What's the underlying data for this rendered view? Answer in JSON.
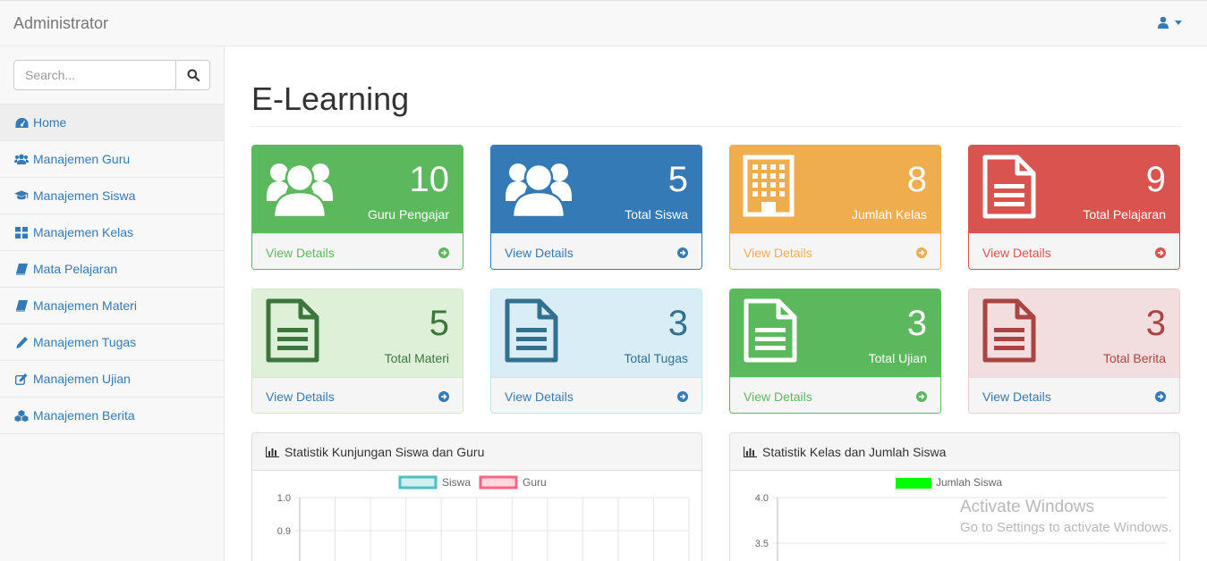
{
  "navbar": {
    "brand": "Administrator"
  },
  "sidebar": {
    "search_placeholder": "Search...",
    "items": [
      {
        "label": "Home"
      },
      {
        "label": "Manajemen Guru"
      },
      {
        "label": "Manajemen Siswa"
      },
      {
        "label": "Manajemen Kelas"
      },
      {
        "label": "Mata Pelajaran"
      },
      {
        "label": "Manajemen Materi"
      },
      {
        "label": "Manajemen Tugas"
      },
      {
        "label": "Manajemen Ujian"
      },
      {
        "label": "Manajemen Berita"
      }
    ]
  },
  "main": {
    "title": "E-Learning",
    "cards": [
      {
        "value": "10",
        "label": "Guru Pengajar",
        "link": "View Details",
        "icon": "users-icon"
      },
      {
        "value": "5",
        "label": "Total Siswa",
        "link": "View Details",
        "icon": "users-icon"
      },
      {
        "value": "8",
        "label": "Jumlah Kelas",
        "link": "View Details",
        "icon": "building-icon"
      },
      {
        "value": "9",
        "label": "Total Pelajaran",
        "link": "View Details",
        "icon": "file-text-icon"
      },
      {
        "value": "5",
        "label": "Total Materi",
        "link": "View Details",
        "icon": "file-text-icon"
      },
      {
        "value": "3",
        "label": "Total Tugas",
        "link": "View Details",
        "icon": "file-text-icon"
      },
      {
        "value": "3",
        "label": "Total Ujian",
        "link": "View Details",
        "icon": "file-text-icon"
      },
      {
        "value": "3",
        "label": "Total Berita",
        "link": "View Details",
        "icon": "file-text-icon"
      }
    ],
    "chart_panels": [
      {
        "title": "Statistik Kunjungan Siswa dan Guru"
      },
      {
        "title": "Statistik Kelas dan Jumlah Siswa"
      }
    ]
  },
  "chart_data": [
    {
      "type": "line",
      "legend_placement": "top",
      "series": [
        {
          "name": "Siswa",
          "color": "#4bc0c0",
          "values": []
        },
        {
          "name": "Guru",
          "color": "#ff6384",
          "values": []
        }
      ],
      "ylim": [
        0,
        1.0
      ],
      "yticks": [
        "1.0",
        "0.9"
      ],
      "grid": true
    },
    {
      "type": "bar",
      "legend_placement": "top",
      "series": [
        {
          "name": "Jumlah Siswa",
          "color": "#00ff00",
          "values": []
        }
      ],
      "ylim": [
        0,
        4.0
      ],
      "yticks": [
        "4.0",
        "3.5"
      ],
      "grid": true
    }
  ],
  "watermark": {
    "line1": "Activate Windows",
    "line2": "Go to Settings to activate Windows."
  },
  "colors": {
    "primary": "#337ab7",
    "success": "#5cb85c",
    "warning": "#f0ad4e",
    "danger": "#d9534f",
    "success_light": "#dff0d8",
    "info_light": "#d9edf7",
    "danger_light": "#f2dede"
  }
}
